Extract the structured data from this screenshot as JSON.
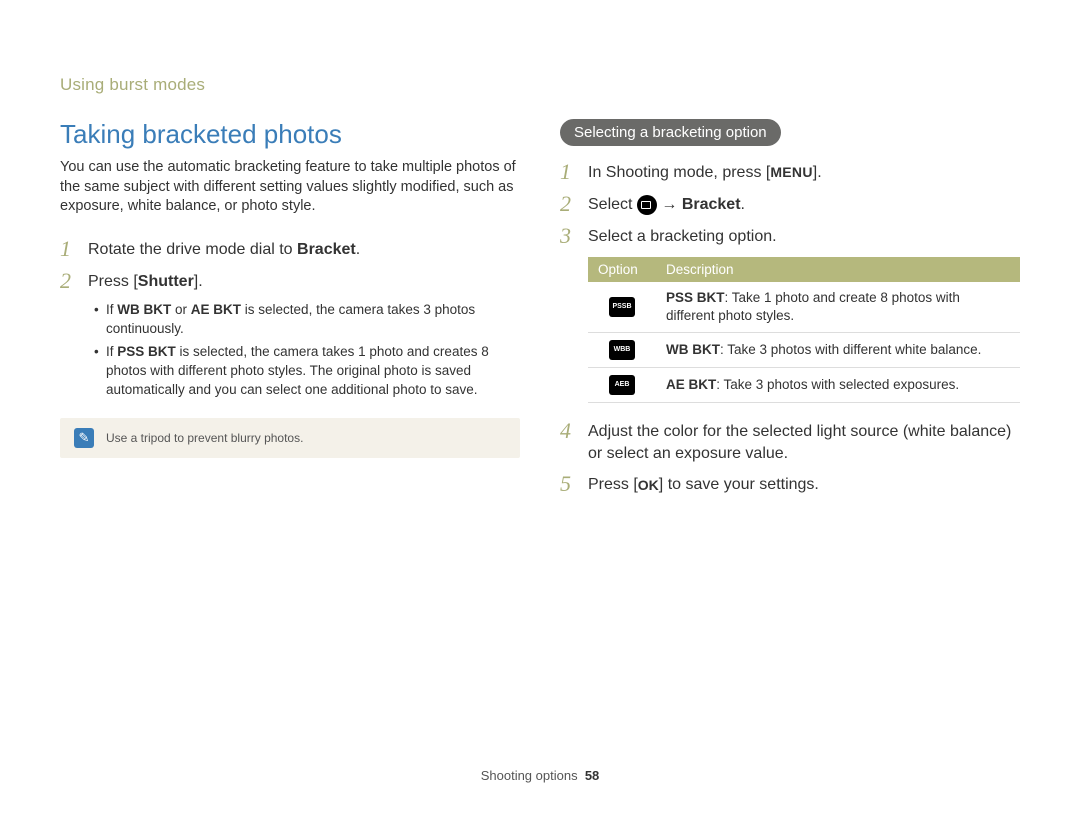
{
  "breadcrumb": "Using burst modes",
  "left": {
    "title": "Taking bracketed photos",
    "intro": "You can use the automatic bracketing feature to take multiple photos of the same subject with different setting values slightly modified, such as exposure, white balance, or photo style.",
    "step1_a": "Rotate the drive mode dial to ",
    "step1_b": "Bracket",
    "step1_c": ".",
    "step2_a": "Press [",
    "step2_b": "Shutter",
    "step2_c": "].",
    "bullet1_a": "If ",
    "bullet1_b": "WB BKT",
    "bullet1_c": " or ",
    "bullet1_d": "AE BKT",
    "bullet1_e": " is selected, the camera takes 3 photos continuously.",
    "bullet2_a": "If ",
    "bullet2_b": "PSS BKT",
    "bullet2_c": " is selected, the camera takes 1 photo and creates 8 photos with different photo styles. The original photo is saved automatically and you can select one additional photo to save.",
    "note": "Use a tripod to prevent blurry photos."
  },
  "right": {
    "pill": "Selecting a bracketing option",
    "step1_a": "In Shooting mode, press [",
    "step1_menu": "MENU",
    "step1_b": "].",
    "step2_a": "Select ",
    "step2_arrow": " → ",
    "step2_b": "Bracket",
    "step2_c": ".",
    "step3": "Select a bracketing option.",
    "step4": "Adjust the color for the selected light source (white balance) or select an exposure value.",
    "step5_a": "Press [",
    "step5_ok": "OK",
    "step5_b": "] to save your settings.",
    "table": {
      "h1": "Option",
      "h2": "Description",
      "rows": [
        {
          "icon": "PSSB",
          "bold": "PSS BKT",
          "rest": ": Take 1 photo and create 8 photos with different photo styles."
        },
        {
          "icon": "WBB",
          "bold": "WB BKT",
          "rest": ": Take 3 photos with different white balance."
        },
        {
          "icon": "AEB",
          "bold": "AE BKT",
          "rest": ": Take 3 photos with selected exposures."
        }
      ]
    }
  },
  "footer": {
    "section": "Shooting options",
    "page": "58"
  }
}
